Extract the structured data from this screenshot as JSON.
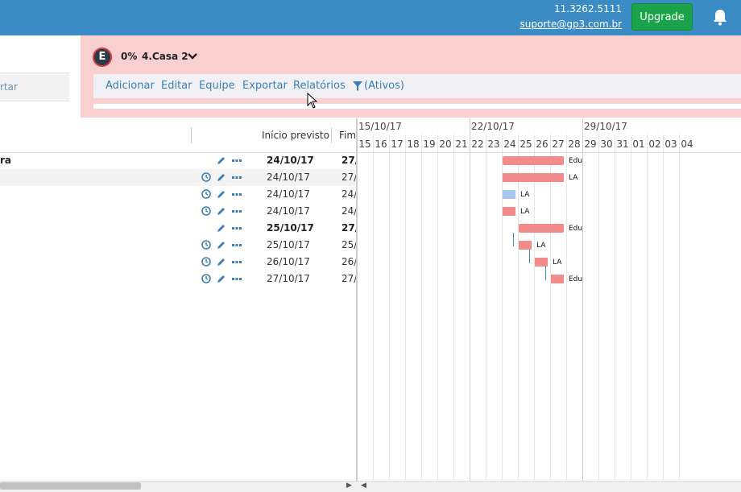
{
  "header": {
    "phone": "11.3262.5111",
    "email": "suporte@gp3.com.br",
    "upgrade_label": "Upgrade"
  },
  "left_panel": {
    "strip_text": "rtar"
  },
  "project": {
    "logo_letter": "E",
    "percent": "0%",
    "name": "4.Casa 2",
    "menu": [
      "Adicionar",
      "Editar",
      "Equipe",
      "Exportar",
      "Relatórios",
      "(Ativos)"
    ]
  },
  "grid": {
    "col_start": "Início previsto",
    "col_end": "Fim",
    "rows": [
      {
        "name": "ra",
        "start": "24/10/17",
        "end": "27/",
        "bold": true
      },
      {
        "name": "",
        "start": "24/10/17",
        "end": "27/",
        "bold": false
      },
      {
        "name": "",
        "start": "24/10/17",
        "end": "24/",
        "bold": false
      },
      {
        "name": "",
        "start": "24/10/17",
        "end": "24/",
        "bold": false
      },
      {
        "name": "",
        "start": "25/10/17",
        "end": "27/",
        "bold": true
      },
      {
        "name": "",
        "start": "25/10/17",
        "end": "25/",
        "bold": false
      },
      {
        "name": "",
        "start": "26/10/17",
        "end": "26/",
        "bold": false
      },
      {
        "name": "",
        "start": "27/10/17",
        "end": "27/",
        "bold": false
      }
    ]
  },
  "gantt": {
    "weeks": [
      "15/10/17",
      "22/10/17",
      "29/10/17"
    ],
    "days": [
      "15",
      "16",
      "17",
      "18",
      "19",
      "20",
      "21",
      "22",
      "23",
      "24",
      "25",
      "26",
      "27",
      "28",
      "29",
      "30",
      "31",
      "01",
      "02",
      "03",
      "04"
    ],
    "bar_labels": [
      "Edu",
      "LA",
      "LA",
      "LA",
      "Edu",
      "LA",
      "LA",
      "Edu"
    ]
  },
  "colors": {
    "topbar": "#3b8bc4",
    "project_bg": "#f9cfcf",
    "upgrade": "#1aa34a",
    "bar": "#f28b8b",
    "bar_blue": "#a6c8ef"
  }
}
